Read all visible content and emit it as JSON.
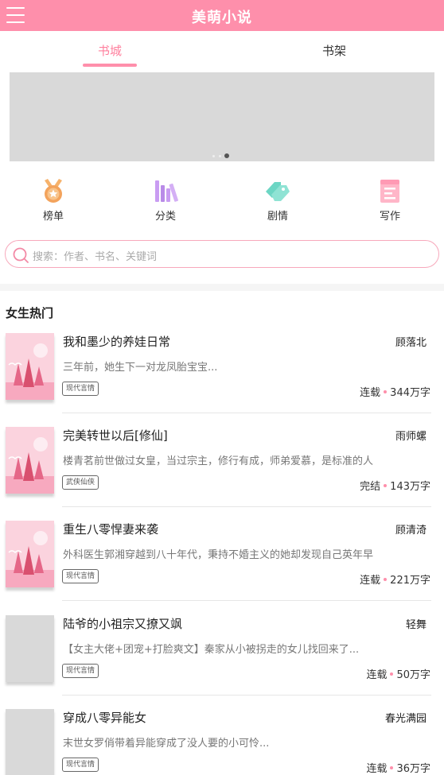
{
  "app": {
    "title": "美萌小说",
    "brand_color": "#fe8fab"
  },
  "tabs": [
    {
      "label": "书城",
      "active": true
    },
    {
      "label": "书架",
      "active": false
    }
  ],
  "carousel": {
    "page_count": 3,
    "active_index": 2
  },
  "quick_nav": [
    {
      "label": "榜单",
      "icon": "medal-icon"
    },
    {
      "label": "分类",
      "icon": "books-icon"
    },
    {
      "label": "剧情",
      "icon": "tags-icon"
    },
    {
      "label": "写作",
      "icon": "note-icon"
    }
  ],
  "search": {
    "placeholder": "搜索：作者、书名、关键词"
  },
  "section": {
    "title": "女生热门"
  },
  "books": [
    {
      "title": "我和墨少的养娃日常",
      "author": "顾落北",
      "desc": "三年前，她生下一对龙凤胎宝宝...",
      "tag": "现代言情",
      "status": "连载",
      "words": "344万字",
      "has_cover": true
    },
    {
      "title": "完美转世以后[修仙]",
      "author": "雨师螺",
      "desc": "楼青茗前世做过女皇，当过宗主，修行有成，师弟爱慕，是标准的人",
      "tag": "武侠仙侠",
      "status": "完结",
      "words": "143万字",
      "has_cover": true
    },
    {
      "title": "重生八零悍妻来袭",
      "author": "顾清渏",
      "desc": "外科医生郭湘穿越到八十年代，秉持不婚主义的她却发现自己英年早",
      "tag": "现代言情",
      "status": "连载",
      "words": "221万字",
      "has_cover": true
    },
    {
      "title": "陆爷的小祖宗又撩又飒",
      "author": "轻舞",
      "desc": "【女主大佬+团宠+打脸爽文】秦家从小被拐走的女儿找回来了...",
      "tag": "现代言情",
      "status": "连载",
      "words": "50万字",
      "has_cover": false
    },
    {
      "title": "穿成八零异能女",
      "author": "春光满园",
      "desc": "末世女罗俏带着异能穿成了没人要的小可怜...",
      "tag": "现代言情",
      "status": "连载",
      "words": "36万字",
      "has_cover": false
    }
  ]
}
